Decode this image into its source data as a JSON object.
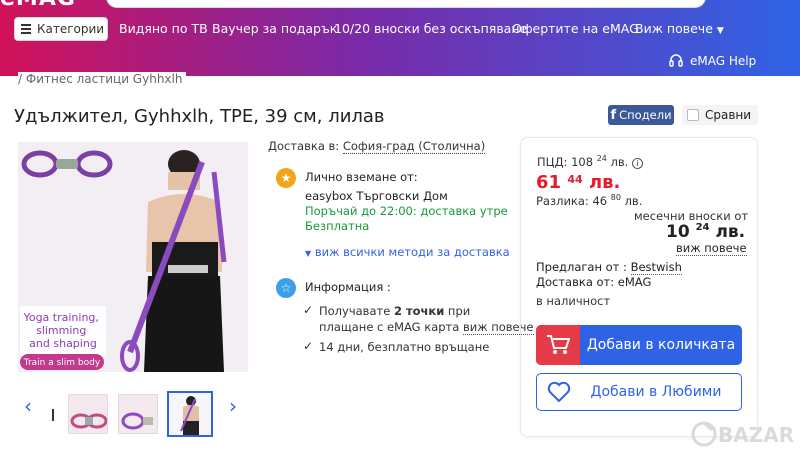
{
  "header": {
    "categories_label": "Категории",
    "nav": [
      "Видяно по ТВ",
      "Ваучер за подарък",
      "10/20 вноски без оскъпяване",
      "Офертите на eMAG",
      "Виж повече"
    ],
    "help_label": "eMAG Help"
  },
  "breadcrumb": "/ Фитнес ластици Gyhhxlh",
  "product": {
    "title": "Удължител, Gyhhxlh, TPE, 39 см, лилав",
    "share_label": "Сподели",
    "compare_label": "Сравни",
    "image_caption_1": "Yoga training, slimming and shaping",
    "image_caption_2": "Train a slim body"
  },
  "delivery": {
    "label": "Доставка в:",
    "location": "София-град (Столична)",
    "pickup_title": "Лично вземане от:",
    "pickup_store": "easybox Търговски Дом",
    "pickup_order": "Поръчай до 22:00: доставка утре",
    "pickup_free": "Безплатна",
    "methods_link": "виж всички методи за доставка"
  },
  "info": {
    "title": "Информация :",
    "line1_a": "Получавате ",
    "line1_bold": "2 точки",
    "line1_b": " при",
    "line2_a": "плащане с eMAG карта ",
    "line2_link": "виж повече",
    "line3": "14 дни, безплатно връщане"
  },
  "pricing": {
    "pcd_label": "ПЦД: 108",
    "pcd_cents": "24",
    "pcd_currency": "лв.",
    "price_main": "61",
    "price_cents": "44",
    "price_currency": "лв.",
    "diff_label": "Разлика: 46",
    "diff_cents": "80",
    "diff_currency": "лв.",
    "monthly_label": "месечни вноски от",
    "monthly_main": "10",
    "monthly_cents": "24",
    "monthly_currency": "лв.",
    "see_more": "виж повече",
    "seller_label": "Предлаган от :",
    "seller_name": "Bestwish",
    "delivery_by": "Доставка от: eMAG",
    "stock": "в наличност",
    "cart_label": "Добави в количката",
    "fav_label": "Добави в Любими"
  },
  "watermark": "BAZAR",
  "colors": {
    "accent": "#2f63e6",
    "price": "#e61c2b",
    "green": "#159a36",
    "cart_icon_bg": "#e63a48",
    "facebook": "#3b5998"
  }
}
